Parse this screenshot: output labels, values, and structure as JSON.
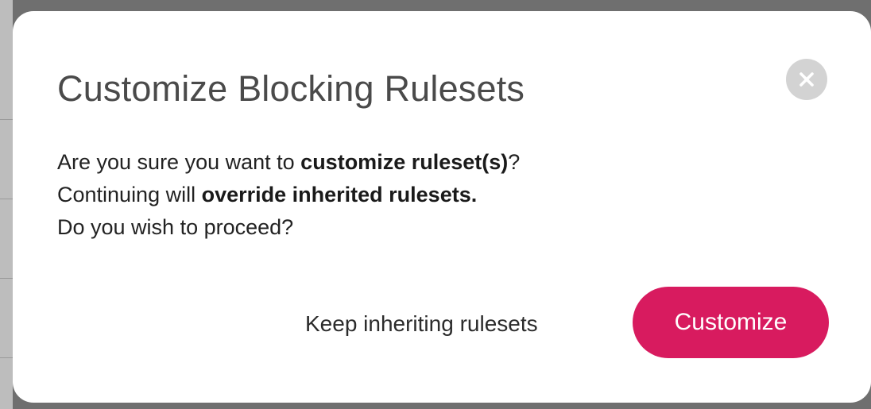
{
  "dialog": {
    "title": "Customize Blocking Rulesets",
    "close_icon": "close-icon",
    "body": {
      "line1_prefix": "Are you sure you want to ",
      "line1_bold": "customize ruleset(s)",
      "line1_suffix": "?",
      "line2_prefix": "Continuing will ",
      "line2_bold": "override inherited rulesets.",
      "line3": "Do you wish to proceed?"
    },
    "secondary_button_label": "Keep inheriting rulesets",
    "primary_button_label": "Customize"
  },
  "colors": {
    "primary_accent": "#d81b5f",
    "close_button_bg": "#d3d3d3",
    "title_text": "#4a4a4a",
    "overlay": "#6f6f6f"
  }
}
